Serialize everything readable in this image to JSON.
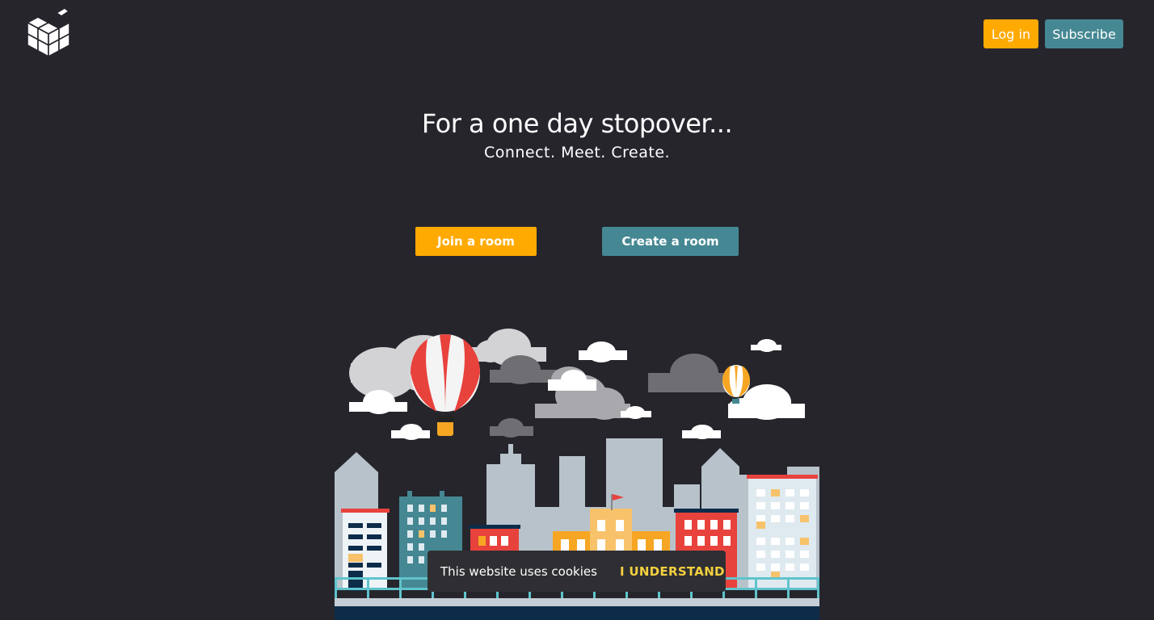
{
  "header": {
    "logo_icon": "cube-logo-icon",
    "login_label": "Log in",
    "subscribe_label": "Subscribe"
  },
  "hero": {
    "title": "For a one day stopover...",
    "subtitle": "Connect. Meet. Create.",
    "join_label": "Join a room",
    "create_label": "Create a room"
  },
  "illustration": {
    "icon": "city-skyline-illustration"
  },
  "cookie_banner": {
    "text": "This website uses cookies",
    "accept_label": "I UNDERSTAND"
  },
  "colors": {
    "background": "#26252c",
    "accent_orange": "#ffaa00",
    "accent_teal": "#458893",
    "cookie_accept": "#f4d03f"
  }
}
